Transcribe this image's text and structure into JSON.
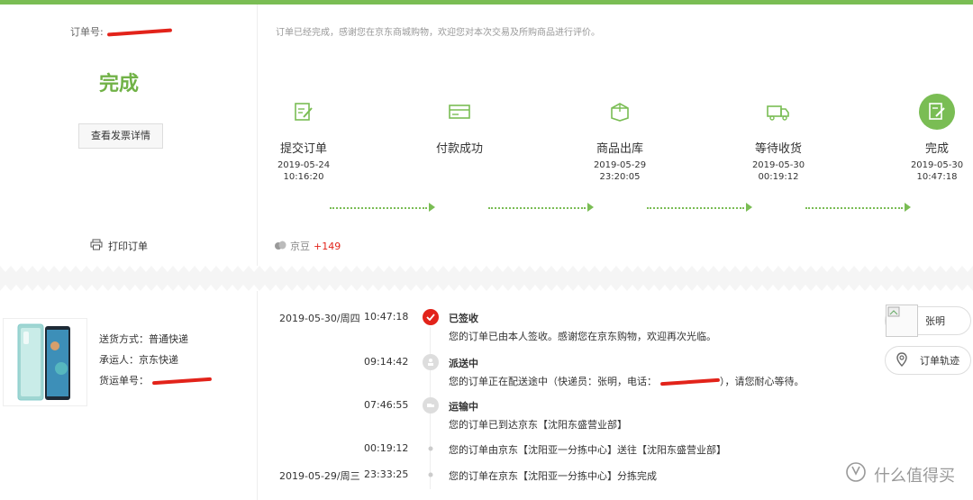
{
  "order": {
    "label": "订单号:",
    "status": "完成",
    "invoice_button": "查看发票详情",
    "print_label": "打印订单",
    "thanks_text": "订单已经完成，感谢您在京东商城购物，欢迎您对本次交易及所购商品进行评价。"
  },
  "steps": [
    {
      "name": "提交订单",
      "date": "2019-05-24",
      "time": "10:16:20",
      "icon": "edit-icon"
    },
    {
      "name": "付款成功",
      "date": "",
      "time": "",
      "icon": "card-icon"
    },
    {
      "name": "商品出库",
      "date": "2019-05-29",
      "time": "23:20:05",
      "icon": "box-icon"
    },
    {
      "name": "等待收货",
      "date": "2019-05-30",
      "time": "00:19:12",
      "icon": "truck-icon"
    },
    {
      "name": "完成",
      "date": "2019-05-30",
      "time": "10:47:18",
      "icon": "check-doc-icon"
    }
  ],
  "bean": {
    "label": "京豆",
    "value": "+149"
  },
  "shipping": {
    "method_label": "送货方式：",
    "method_value": "普通快递",
    "carrier_label": "承运人：",
    "carrier_value": "京东快递",
    "tracking_label": "货运单号："
  },
  "tracking": [
    {
      "date": "2019-05-30/周四",
      "time": "10:47:18",
      "title": "已签收",
      "text": "您的订单已由本人签收。感谢您在京东购物，欢迎再次光临。"
    },
    {
      "date": "",
      "time": "09:14:42",
      "title": "派送中",
      "text_a": "您的订单正在配送途中（快递员：张明，电话：",
      "text_b": "），请您耐心等待。"
    },
    {
      "date": "",
      "time": "07:46:55",
      "title": "运输中",
      "text": "您的订单已到达京东【沈阳东盛营业部】"
    },
    {
      "date": "",
      "time": "00:19:12",
      "title": "",
      "text": "您的订单由京东【沈阳亚一分拣中心】送往【沈阳东盛营业部】"
    },
    {
      "date": "2019-05-29/周三",
      "time": "23:33:25",
      "title": "",
      "text": "您的订单在京东【沈阳亚一分拣中心】分拣完成"
    }
  ],
  "side": {
    "courier_name": "张明",
    "track_button": "订单轨迹"
  },
  "watermark": "什么值得买",
  "colors": {
    "accent": "#7abd54",
    "red": "#e2231a"
  }
}
